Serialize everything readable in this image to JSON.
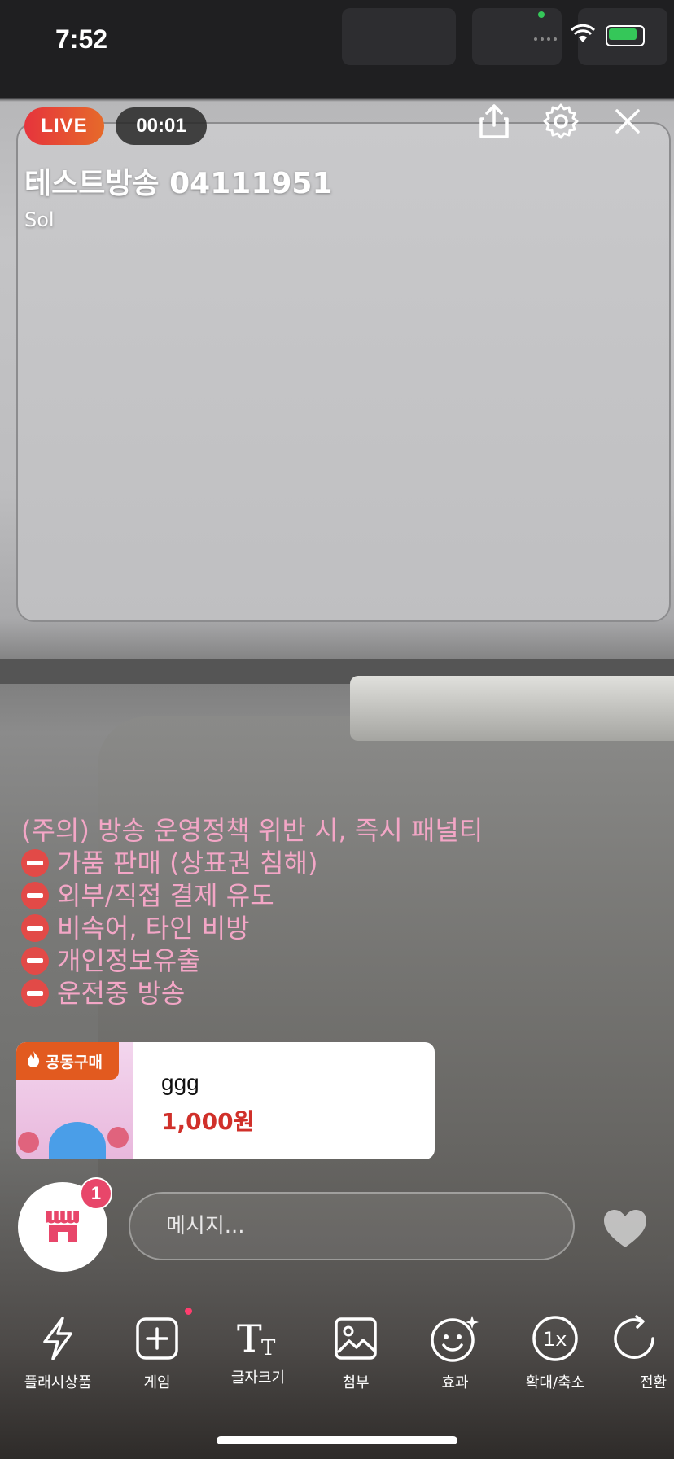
{
  "status_bar": {
    "time": "7:52"
  },
  "header": {
    "live_label": "LIVE",
    "timer": "00:01",
    "title": "테스트방송 04111951",
    "host_name": "Sol"
  },
  "notice": {
    "heading": "(주의) 방송 운영정책 위반 시, 즉시 패널티",
    "items": [
      "가품 판매 (상표권 침해)",
      "외부/직접 결제 유도",
      "비속어, 타인 비방",
      "개인정보유출",
      "운전중 방송"
    ]
  },
  "product": {
    "badge": "공동구매",
    "name": "ggg",
    "price": "1,000원"
  },
  "shop": {
    "badge_count": "1"
  },
  "message": {
    "placeholder": "메시지..."
  },
  "toolbar": {
    "items": [
      {
        "label": "플래시상품",
        "icon": "flash-icon"
      },
      {
        "label": "게임",
        "icon": "plus-square-icon"
      },
      {
        "label": "글자크기",
        "icon": "text-size-icon"
      },
      {
        "label": "첨부",
        "icon": "image-icon"
      },
      {
        "label": "효과",
        "icon": "face-sparkle-icon"
      },
      {
        "label": "확대/축소",
        "icon": "zoom-1x-icon"
      },
      {
        "label": "전환",
        "icon": "rotate-camera-icon"
      }
    ]
  },
  "colors": {
    "live_gradient_start": "#e6343c",
    "live_gradient_end": "#e66a2a",
    "notice_text": "#f3a6c6",
    "price": "#d0302a",
    "badge": "#e8466a",
    "deal_badge": "#e25a1f"
  }
}
